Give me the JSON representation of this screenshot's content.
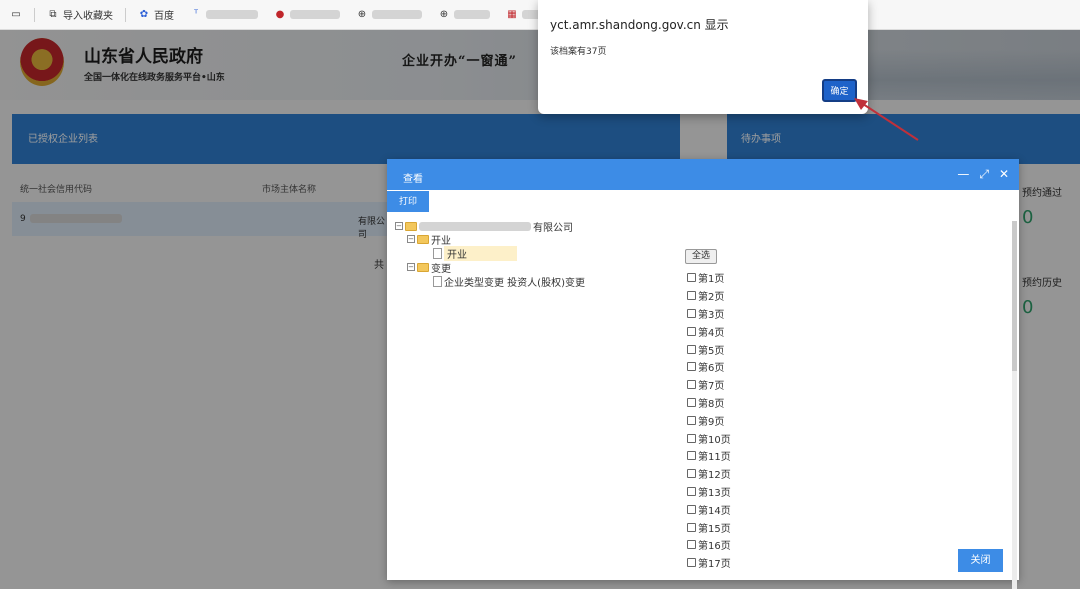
{
  "bookmarks": {
    "import_label": "导入收藏夹",
    "baidu_label": "百度"
  },
  "header": {
    "gov_title": "山东省人民政府",
    "gov_subtitle": "全国一体化在线政务服务平台•山东",
    "slogan": "企业开办“一窗通”"
  },
  "left_panel": {
    "title": "已授权企业列表",
    "col_credit_code": "统一社会信用代码",
    "col_entity_name": "市场主体名称",
    "row_code_prefix": "9",
    "row_name_suffix": "有限公司",
    "total_prefix": "共"
  },
  "right_panel": {
    "title": "待办事项",
    "stats": [
      {
        "label": "预约通过",
        "value": "0"
      },
      {
        "label": "预约历史",
        "value": "0"
      }
    ]
  },
  "dialog": {
    "title": "查看",
    "print_label": "打印",
    "select_all_label": "全选",
    "close_label": "关闭",
    "tree": {
      "root_suffix": "有限公司",
      "folder_open": "开业",
      "file_open": "开业",
      "folder_change": "变更",
      "file_change": "企业类型变更 投资人(股权)变更"
    },
    "pages": [
      "第1页",
      "第2页",
      "第3页",
      "第4页",
      "第5页",
      "第6页",
      "第7页",
      "第8页",
      "第9页",
      "第10页",
      "第11页",
      "第12页",
      "第13页",
      "第14页",
      "第15页",
      "第16页",
      "第17页"
    ]
  },
  "alert": {
    "title": "yct.amr.shandong.gov.cn 显示",
    "message": "该档案有37页",
    "ok_label": "确定"
  },
  "colors": {
    "primary_blue": "#3d8ce6",
    "panel_blue": "#2f7fd0",
    "stat_green": "#2e9e6a",
    "arrow_red": "#c0303a"
  }
}
